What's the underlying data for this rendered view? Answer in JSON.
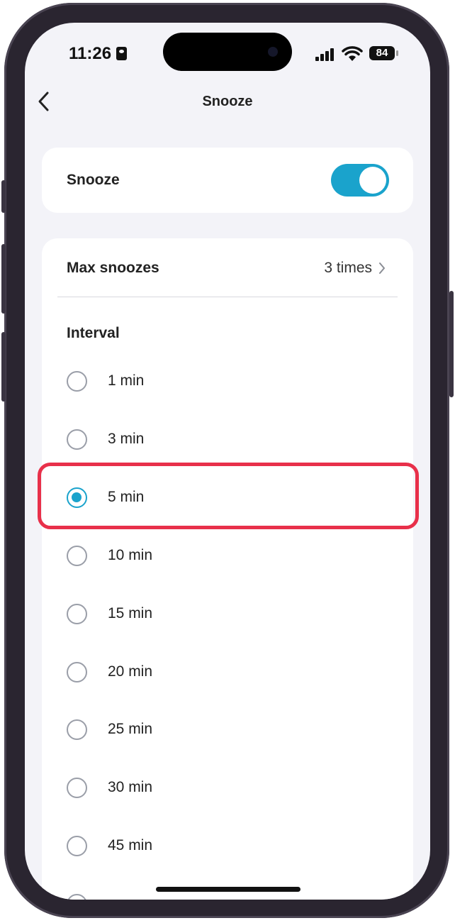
{
  "status_bar": {
    "time": "11:26",
    "battery": "84"
  },
  "header": {
    "title": "Snooze"
  },
  "snooze_toggle": {
    "label": "Snooze",
    "enabled": true
  },
  "max_snoozes": {
    "label": "Max snoozes",
    "value": "3 times"
  },
  "interval": {
    "label": "Interval",
    "options": [
      {
        "label": "1 min",
        "selected": false
      },
      {
        "label": "3 min",
        "selected": false
      },
      {
        "label": "5 min",
        "selected": true
      },
      {
        "label": "10 min",
        "selected": false
      },
      {
        "label": "15 min",
        "selected": false
      },
      {
        "label": "20 min",
        "selected": false
      },
      {
        "label": "25 min",
        "selected": false
      },
      {
        "label": "30 min",
        "selected": false
      },
      {
        "label": "45 min",
        "selected": false
      }
    ]
  },
  "colors": {
    "accent": "#1aa3cc",
    "highlight": "#e8304a",
    "background": "#f3f3f8"
  }
}
